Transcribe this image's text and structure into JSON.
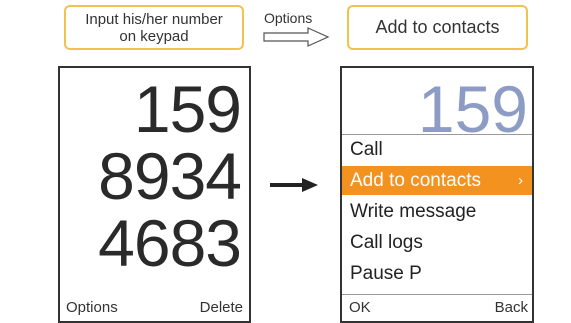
{
  "callouts": {
    "left_line1": "Input his/her number",
    "left_line2": "on keypad",
    "right": "Add to contacts"
  },
  "transition": {
    "options_label": "Options"
  },
  "left_phone": {
    "number_lines": [
      "159",
      "8934",
      "4683"
    ],
    "softkey_left": "Options",
    "softkey_right": "Delete"
  },
  "right_phone": {
    "background_number": "159",
    "menu": [
      {
        "label": "Call"
      },
      {
        "label": "Add to contacts",
        "selected": true,
        "chevron": "›"
      },
      {
        "label": "Write message"
      },
      {
        "label": "Call logs"
      },
      {
        "label": "Pause P"
      }
    ],
    "softkey_left": "OK",
    "softkey_right": "Back"
  },
  "colors": {
    "callout_border": "#f0c24e",
    "highlight": "#f3921f",
    "faded_number": "#8d9cc4"
  }
}
